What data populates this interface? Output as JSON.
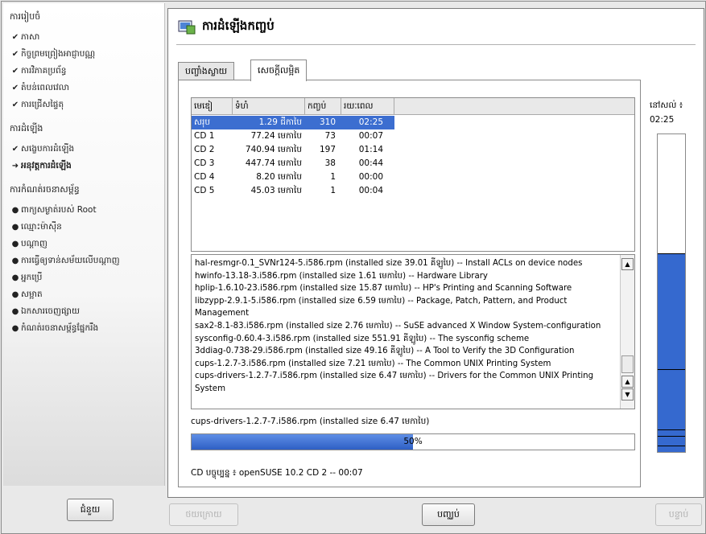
{
  "sidebar": {
    "section_preparation": "ការរៀបចំ",
    "prep_items": [
      "ភាសា",
      "កិច្ចព្រមព្រៀងអាជ្ញាបណ្ណ",
      "ការវិភាគប្រព័ន្ធ",
      "តំបន់ពេលវេលា",
      "ការជ្រើសផ្ទៃតុ"
    ],
    "section_install": "ការដំឡើង",
    "install_items": [
      "សង្ខេបការដំឡើង",
      "អនុវត្តការដំឡើង"
    ],
    "section_config": "ការកំណត់រចនាសម្ព័ន្ធ",
    "config_items": [
      "ពាក្យសម្ងាត់របស់ Root",
      "ឈ្មោះម៉ាស៊ីន",
      "បណ្ដាញ",
      "ការធ្វើឲ្យទាន់សម័យលើបណ្ដាញ",
      "អ្នកប្រើ",
      "សម្អាត",
      "ឯកសារចេញផ្សាយ",
      "កំណត់រចនាសម្ព័ន្ធផ្នែករឹង"
    ],
    "icons": {
      "done": "check-icon",
      "current": "arrow-right-icon",
      "pending": "bullet-icon"
    }
  },
  "header": {
    "title": "ការដំឡើងកញ្ចប់",
    "icon": "package-install-icon"
  },
  "tabs": [
    "បញ្ចាំងស្លាយ",
    "សេចក្ដីលម្អិត"
  ],
  "cd_table": {
    "columns": [
      "មេឌៀ",
      "ទំហំ",
      "កញ្ចប់",
      "រយៈពេល"
    ],
    "rows": [
      {
        "media": "សរុប",
        "size": "1.29 ជីកាបៃ",
        "packages": "310",
        "time": "02:25"
      },
      {
        "media": "CD 1",
        "size": "77.24 មេកាបៃ",
        "packages": "73",
        "time": "00:07"
      },
      {
        "media": "CD 2",
        "size": "740.94 មេកាបៃ",
        "packages": "197",
        "time": "01:14"
      },
      {
        "media": "CD 3",
        "size": "447.74 មេកាបៃ",
        "packages": "38",
        "time": "00:44"
      },
      {
        "media": "CD 4",
        "size": "8.20 មេកាបៃ",
        "packages": "1",
        "time": "00:00"
      },
      {
        "media": "CD 5",
        "size": "45.03 មេកាបៃ",
        "packages": "1",
        "time": "00:04"
      }
    ]
  },
  "package_log": [
    "hal-resmgr-0.1_SVNr124-5.i586.rpm (installed size 39.01 គីឡូបៃ) -- Install ACLs on device nodes",
    "hwinfo-13.18-3.i586.rpm (installed size 1.61 មេកាបៃ) -- Hardware Library",
    "hplip-1.6.10-23.i586.rpm (installed size 15.87 មេកាបៃ) -- HP's Printing and Scanning Software",
    "libzypp-2.9.1-5.i586.rpm (installed size 6.59 មេកាបៃ) -- Package, Patch, Pattern, and Product Management",
    "sax2-8.1-83.i586.rpm (installed size 2.76 មេកាបៃ) -- SuSE advanced X Window System-configuration",
    "sysconfig-0.60.4-3.i586.rpm (installed size 551.91 គីឡូបៃ) -- The sysconfig scheme",
    "3ddiag-0.738-29.i586.rpm (installed size 49.16 គីឡូបៃ) -- A Tool to Verify the 3D Configuration",
    "cups-1.2.7-3.i586.rpm (installed size 7.21 មេកាបៃ) -- The Common UNIX Printing System",
    "cups-drivers-1.2.7-7.i586.rpm (installed size 6.47 មេកាបៃ) -- Drivers for the Common UNIX Printing System"
  ],
  "current_package": "cups-drivers-1.2.7-7.i586.rpm (installed size 6.47 មេកាបៃ)",
  "progress": {
    "percent": 50,
    "label": "50%"
  },
  "cd_status": "CD បច្ចុប្បន្ន ៖ openSUSE 10.2 CD 2 -- 00:07",
  "remaining": {
    "label": "នៅសល់ ៖",
    "time": "02:25",
    "fraction": 0.625,
    "cd_marks": [
      0.625,
      0.26,
      0.07,
      0.05,
      0.02
    ]
  },
  "buttons": {
    "help": "ជំនួយ",
    "back": "ថយក្រោយ",
    "abort": "បញ្ឈប់",
    "next": "បន្ទាប់"
  }
}
